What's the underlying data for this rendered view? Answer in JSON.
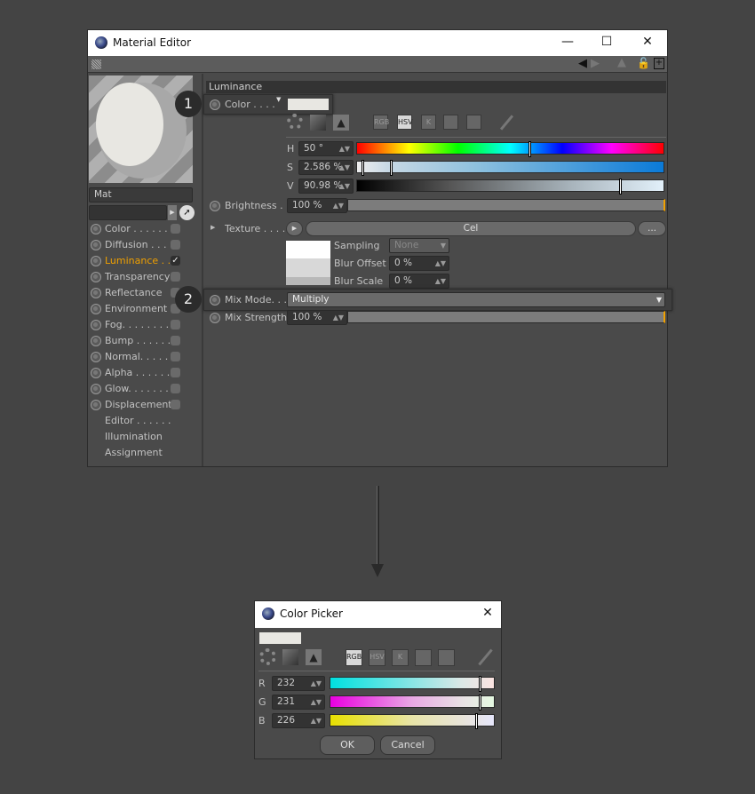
{
  "material_editor": {
    "title": "Material Editor",
    "material_name": "Mat",
    "channels": [
      {
        "label": "Color . . . . . .",
        "enabled": false
      },
      {
        "label": "Diffusion . . .",
        "enabled": false
      },
      {
        "label": "Luminance . .",
        "enabled": true,
        "active": true
      },
      {
        "label": "Transparency",
        "enabled": false
      },
      {
        "label": "Reflectance",
        "enabled": false
      },
      {
        "label": "Environment",
        "enabled": false
      },
      {
        "label": "Fog. . . . . . . .",
        "enabled": false
      },
      {
        "label": "Bump . . . . . .",
        "enabled": false
      },
      {
        "label": "Normal. . . . .",
        "enabled": false
      },
      {
        "label": "Alpha . . . . . .",
        "enabled": false
      },
      {
        "label": "Glow. . . . . . .",
        "enabled": false
      },
      {
        "label": "Displacement",
        "enabled": false
      }
    ],
    "extra_items": [
      "Editor . . . . . .",
      "Illumination",
      "Assignment"
    ],
    "section_title": "Luminance",
    "color_label": "Color . . . .",
    "color_swatch": "#e8e7e2",
    "mode_buttons": [
      "RGB",
      "HSV",
      "K"
    ],
    "active_mode": "HSV",
    "hsv": {
      "h_label": "H",
      "h_value": "50 °",
      "s_label": "S",
      "s_value": "2.586 %",
      "v_label": "V",
      "v_value": "90.98 %"
    },
    "brightness_label": "Brightness . .",
    "brightness_value": "100 %",
    "texture_label": "Texture . . . . .",
    "texture_value": "Cel",
    "texture_more": "...",
    "sampling_label": "Sampling",
    "sampling_value": "None",
    "blur_offset_label": "Blur Offset",
    "blur_offset_value": "0 %",
    "blur_scale_label": "Blur Scale",
    "blur_scale_value": "0 %",
    "mix_mode_label": "Mix Mode. . .",
    "mix_mode_value": "Multiply",
    "mix_strength_label": "Mix Strength",
    "mix_strength_value": "100 %",
    "callouts": [
      "1",
      "2"
    ],
    "accent_color": "#f0a000"
  },
  "color_picker": {
    "title": "Color Picker",
    "swatch": "#e8e7e2",
    "mode_buttons": [
      "RGB",
      "HSV",
      "K"
    ],
    "active_mode": "RGB",
    "r_label": "R",
    "r_value": "232",
    "g_label": "G",
    "g_value": "231",
    "b_label": "B",
    "b_value": "226",
    "ok_label": "OK",
    "cancel_label": "Cancel"
  }
}
